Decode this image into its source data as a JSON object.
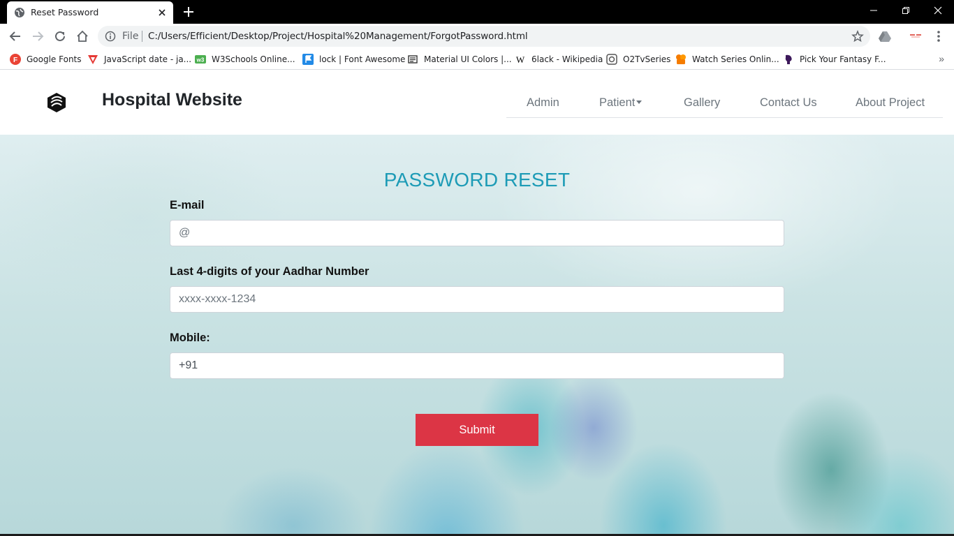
{
  "browser": {
    "tab": {
      "title": "Reset Password"
    },
    "address_bar": {
      "scheme_label": "File",
      "url": "C:/Users/Efficient/Desktop/Project/Hospital%20Management/ForgotPassword.html"
    },
    "bookmarks": [
      {
        "label": "Google Fonts",
        "icon": "google-fonts-icon",
        "color": "#ea4335"
      },
      {
        "label": "JavaScript date - ja...",
        "icon": "triangle-icon",
        "color": "#e53935"
      },
      {
        "label": "W3Schools Online...",
        "icon": "w3schools-icon",
        "color": "#4caf50"
      },
      {
        "label": "lock | Font Awesome",
        "icon": "flag-icon",
        "color": "#228ae6"
      },
      {
        "label": "Material UI Colors |...",
        "icon": "newspaper-icon",
        "color": "#333333"
      },
      {
        "label": "6lack - Wikipedia",
        "icon": "wikipedia-icon",
        "color": "#000000"
      },
      {
        "label": "O2TvSeries",
        "icon": "o2tv-icon",
        "color": "#555555"
      },
      {
        "label": "Watch Series Onlin...",
        "icon": "watch-series-icon",
        "color": "#f57c00"
      },
      {
        "label": "Pick Your Fantasy F...",
        "icon": "premier-league-icon",
        "color": "#3d195b"
      }
    ]
  },
  "site": {
    "brand": {
      "title": "Hospital Website"
    },
    "nav": [
      {
        "label": "Admin"
      },
      {
        "label": "Patient"
      },
      {
        "label": "Gallery"
      },
      {
        "label": "Contact Us"
      },
      {
        "label": "About Project"
      }
    ]
  },
  "form": {
    "title": "PASSWORD RESET",
    "email": {
      "label": "E-mail",
      "placeholder": "@",
      "value": ""
    },
    "aadhar": {
      "label": "Last 4-digits of your Aadhar Number",
      "placeholder": "xxxx-xxxx-1234",
      "value": ""
    },
    "mobile": {
      "label": "Mobile:",
      "placeholder": "",
      "value": "+91"
    },
    "submit_label": "Submit"
  },
  "colors": {
    "title": "#1d9bb6",
    "submit": "#dc3545",
    "nav_text": "#6c757d"
  }
}
